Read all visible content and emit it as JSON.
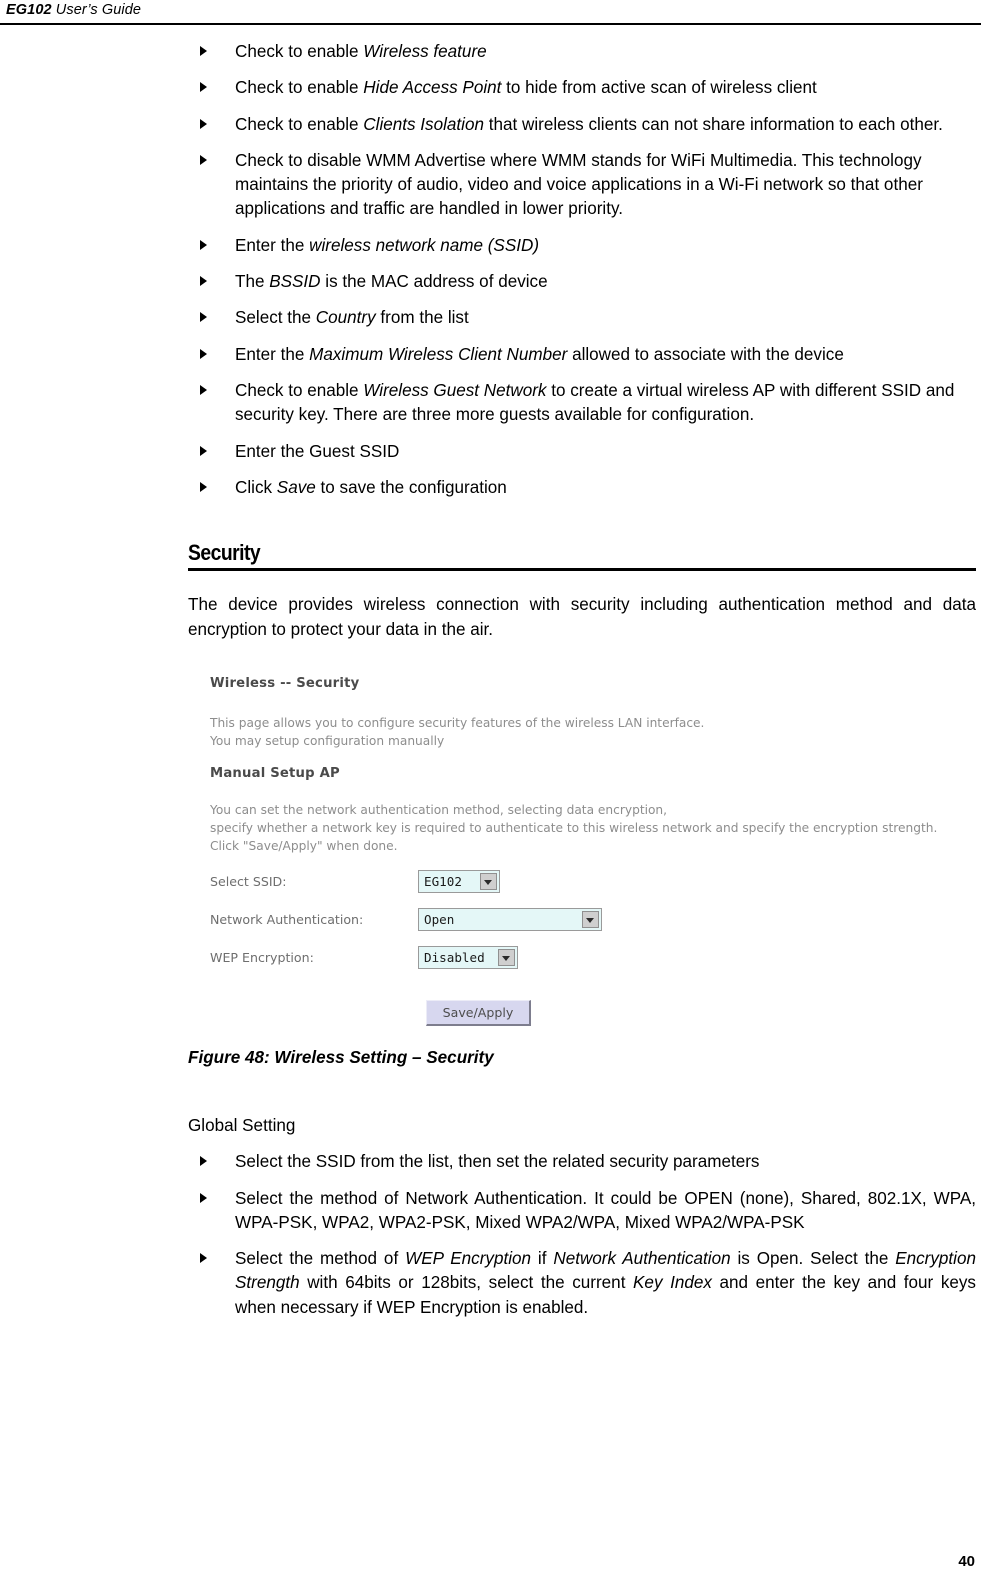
{
  "header": {
    "model": "EG102",
    "guide": " User’s Guide"
  },
  "top_bullets": [
    {
      "html": "Check to enable <i>Wireless feature</i>",
      "justify": false
    },
    {
      "html": "Check to enable <i>Hide Access Point</i> to hide from active scan of wireless client",
      "justify": false
    },
    {
      "html": "Check to enable <i>Clients Isolation</i> that wireless clients can not share information to each other.",
      "justify": false
    },
    {
      "html": "Check to disable WMM Advertise where WMM stands for WiFi Multimedia. This technology maintains the priority of audio, video and voice applications in a Wi-Fi network so that other applications and traffic are handled in lower priority.",
      "justify": false
    },
    {
      "html": "Enter the <i>wireless network name (SSID)</i>",
      "justify": false
    },
    {
      "html": "The <i>BSSID</i> is the MAC address of device",
      "justify": false
    },
    {
      "html": "Select the <i>Country</i> from the list",
      "justify": false
    },
    {
      "html": "Enter the <i>Maximum Wireless Client Number</i> allowed to associate with the device",
      "justify": false
    },
    {
      "html": "Check to enable <i>Wireless Guest Network</i> to create a virtual wireless AP with different SSID and security key. There are three more guests available for configuration.",
      "justify": false
    },
    {
      "html": "Enter the Guest SSID",
      "justify": false
    },
    {
      "html": "Click <i>Save</i> to save the configuration",
      "justify": false
    }
  ],
  "security_section": {
    "title": "Security",
    "paragraph": "The device provides wireless connection with security including authentication method and data encryption to protect your data in the air."
  },
  "figure": {
    "heading_1": "Wireless -- Security",
    "paragraph_1_line_1": "This page allows you to configure security features of the wireless LAN interface.",
    "paragraph_1_line_2": "You may setup configuration manually",
    "heading_2": "Manual Setup AP",
    "paragraph_2_line_1": "You can set the network authentication method, selecting data encryption,",
    "paragraph_2_line_2": "specify whether a network key is required to authenticate to this wireless network and specify the encryption strength.",
    "paragraph_2_line_3": "Click \"Save/Apply\" when done.",
    "fields": [
      {
        "label": "Select SSID:",
        "value": "EG102"
      },
      {
        "label": "Network Authentication:",
        "value": "Open"
      },
      {
        "label": "WEP Encryption:",
        "value": "Disabled"
      }
    ],
    "save_button": "Save/Apply",
    "colors": {
      "select_background": "#e4f7f7",
      "select_border": "#9a9a9a",
      "button_background": "#d7d7ef",
      "text_gray": "#8d8d8d"
    }
  },
  "caption": "Figure 48: Wireless Setting – Security",
  "global_setting": {
    "subhead": "Global Setting",
    "bullets": [
      {
        "html": "Select the SSID from the list, then set the related security parameters",
        "justify": false
      },
      {
        "html": "Select the method of Network Authentication. It could be OPEN (none), Shared, 802.1X, WPA, WPA-PSK, WPA2, WPA2-PSK, Mixed WPA2/WPA, Mixed WPA2/WPA-PSK",
        "justify": true
      },
      {
        "html": "Select the method of <i>WEP Encryption</i> if <i>Network Authentication</i> is Open. Select the <i>Encryption Strength</i> with 64bits or 128bits, select the current <i>Key Index</i> and enter the key and four keys when necessary if WEP Encryption is enabled.",
        "justify": true
      }
    ]
  },
  "page_number": "40"
}
